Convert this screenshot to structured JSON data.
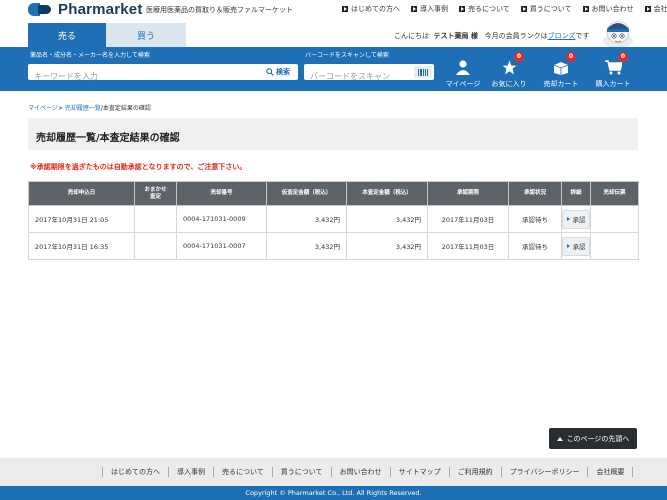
{
  "brand": {
    "logo_text": "Pharmarket",
    "tagline": "医療用医薬品の買取り＆販売ファルマーケット"
  },
  "topnav": [
    "はじめての方へ",
    "導入事例",
    "売るについて",
    "買うについて",
    "お問い合わせ",
    "会社概要"
  ],
  "tabs": {
    "sell": "売る",
    "buy": "買う"
  },
  "greeting": {
    "prefix": "こんにちは",
    "user": "テスト薬局 様",
    "rank_prefix": "今月の会員ランクは",
    "rank": "ブロンズ",
    "rank_suffix": "です"
  },
  "search": {
    "label": "薬品名・成分名・メーカー名を入力して検索",
    "placeholder": "キーワードを入力",
    "button": "検索",
    "barcode_label": "バーコードをスキャンして検索",
    "barcode_placeholder": "バーコードをスキャン"
  },
  "nav_icons": {
    "mypage": "マイページ",
    "favorites": "お気に入り",
    "favorites_count": "0",
    "sell_cart": "売却カート",
    "sell_cart_count": "0",
    "buy_cart": "購入カート",
    "buy_cart_count": "0"
  },
  "breadcrumb": {
    "home": "マイページ",
    "sep": "> ",
    "history": "売却履歴一覧",
    "current": "/本査定結果の確認"
  },
  "page_title": "売却履歴一覧/本査定結果の確認",
  "warning": "※承認期限を過ぎたものは自動承認となりますので、ご注意下さい。",
  "table": {
    "headers": [
      "売却申込日",
      "おまかせ\n査定",
      "売却番号",
      "仮査定金額（税込）",
      "本査定金額（税込）",
      "承認期限",
      "承認状況",
      "詳細",
      "売却伝票"
    ],
    "rows": [
      {
        "date": "2017年10月31日 21:05",
        "omakase": "",
        "number": "0004-171031-0009",
        "provisional": "3,432円",
        "final": "3,432円",
        "deadline": "2017年11月03日",
        "status": "承認待ち",
        "detail": "承認",
        "slip": ""
      },
      {
        "date": "2017年10月31日 16:35",
        "omakase": "",
        "number": "0004-171031-0007",
        "provisional": "3,432円",
        "final": "3,432円",
        "deadline": "2017年11月03日",
        "status": "承認待ち",
        "detail": "承認",
        "slip": ""
      }
    ]
  },
  "to_top": "このページの先頭へ",
  "footer": {
    "links": [
      "はじめての方へ",
      "導入事例",
      "売るについて",
      "買うについて",
      "お問い合わせ",
      "サイトマップ",
      "ご利用規約",
      "プライバシーポリシー",
      "会社概要"
    ],
    "copyright": "Copyright © Pharmarket Co., Ltd. All Rights Reserved."
  },
  "colors": {
    "brand_blue": "#1e6fb5",
    "alert_red": "#e0281e",
    "table_header": "#5d6369"
  }
}
